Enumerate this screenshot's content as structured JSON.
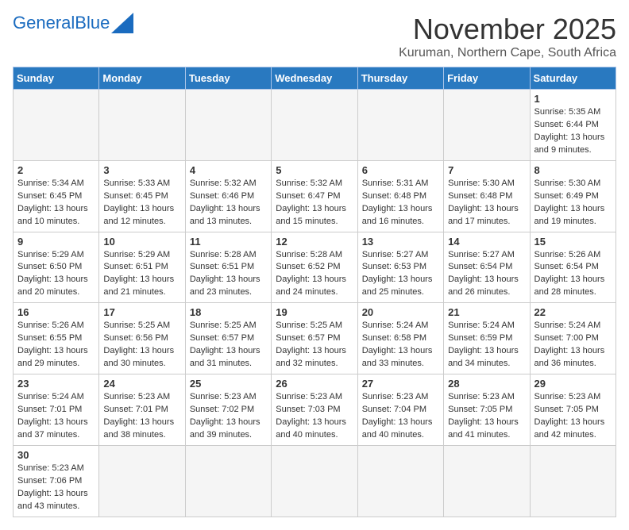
{
  "header": {
    "logo_general": "General",
    "logo_blue": "Blue",
    "month": "November 2025",
    "location": "Kuruman, Northern Cape, South Africa"
  },
  "days_of_week": [
    "Sunday",
    "Monday",
    "Tuesday",
    "Wednesday",
    "Thursday",
    "Friday",
    "Saturday"
  ],
  "weeks": [
    [
      {
        "day": "",
        "info": ""
      },
      {
        "day": "",
        "info": ""
      },
      {
        "day": "",
        "info": ""
      },
      {
        "day": "",
        "info": ""
      },
      {
        "day": "",
        "info": ""
      },
      {
        "day": "",
        "info": ""
      },
      {
        "day": "1",
        "info": "Sunrise: 5:35 AM\nSunset: 6:44 PM\nDaylight: 13 hours and 9 minutes."
      }
    ],
    [
      {
        "day": "2",
        "info": "Sunrise: 5:34 AM\nSunset: 6:45 PM\nDaylight: 13 hours and 10 minutes."
      },
      {
        "day": "3",
        "info": "Sunrise: 5:33 AM\nSunset: 6:45 PM\nDaylight: 13 hours and 12 minutes."
      },
      {
        "day": "4",
        "info": "Sunrise: 5:32 AM\nSunset: 6:46 PM\nDaylight: 13 hours and 13 minutes."
      },
      {
        "day": "5",
        "info": "Sunrise: 5:32 AM\nSunset: 6:47 PM\nDaylight: 13 hours and 15 minutes."
      },
      {
        "day": "6",
        "info": "Sunrise: 5:31 AM\nSunset: 6:48 PM\nDaylight: 13 hours and 16 minutes."
      },
      {
        "day": "7",
        "info": "Sunrise: 5:30 AM\nSunset: 6:48 PM\nDaylight: 13 hours and 17 minutes."
      },
      {
        "day": "8",
        "info": "Sunrise: 5:30 AM\nSunset: 6:49 PM\nDaylight: 13 hours and 19 minutes."
      }
    ],
    [
      {
        "day": "9",
        "info": "Sunrise: 5:29 AM\nSunset: 6:50 PM\nDaylight: 13 hours and 20 minutes."
      },
      {
        "day": "10",
        "info": "Sunrise: 5:29 AM\nSunset: 6:51 PM\nDaylight: 13 hours and 21 minutes."
      },
      {
        "day": "11",
        "info": "Sunrise: 5:28 AM\nSunset: 6:51 PM\nDaylight: 13 hours and 23 minutes."
      },
      {
        "day": "12",
        "info": "Sunrise: 5:28 AM\nSunset: 6:52 PM\nDaylight: 13 hours and 24 minutes."
      },
      {
        "day": "13",
        "info": "Sunrise: 5:27 AM\nSunset: 6:53 PM\nDaylight: 13 hours and 25 minutes."
      },
      {
        "day": "14",
        "info": "Sunrise: 5:27 AM\nSunset: 6:54 PM\nDaylight: 13 hours and 26 minutes."
      },
      {
        "day": "15",
        "info": "Sunrise: 5:26 AM\nSunset: 6:54 PM\nDaylight: 13 hours and 28 minutes."
      }
    ],
    [
      {
        "day": "16",
        "info": "Sunrise: 5:26 AM\nSunset: 6:55 PM\nDaylight: 13 hours and 29 minutes."
      },
      {
        "day": "17",
        "info": "Sunrise: 5:25 AM\nSunset: 6:56 PM\nDaylight: 13 hours and 30 minutes."
      },
      {
        "day": "18",
        "info": "Sunrise: 5:25 AM\nSunset: 6:57 PM\nDaylight: 13 hours and 31 minutes."
      },
      {
        "day": "19",
        "info": "Sunrise: 5:25 AM\nSunset: 6:57 PM\nDaylight: 13 hours and 32 minutes."
      },
      {
        "day": "20",
        "info": "Sunrise: 5:24 AM\nSunset: 6:58 PM\nDaylight: 13 hours and 33 minutes."
      },
      {
        "day": "21",
        "info": "Sunrise: 5:24 AM\nSunset: 6:59 PM\nDaylight: 13 hours and 34 minutes."
      },
      {
        "day": "22",
        "info": "Sunrise: 5:24 AM\nSunset: 7:00 PM\nDaylight: 13 hours and 36 minutes."
      }
    ],
    [
      {
        "day": "23",
        "info": "Sunrise: 5:24 AM\nSunset: 7:01 PM\nDaylight: 13 hours and 37 minutes."
      },
      {
        "day": "24",
        "info": "Sunrise: 5:23 AM\nSunset: 7:01 PM\nDaylight: 13 hours and 38 minutes."
      },
      {
        "day": "25",
        "info": "Sunrise: 5:23 AM\nSunset: 7:02 PM\nDaylight: 13 hours and 39 minutes."
      },
      {
        "day": "26",
        "info": "Sunrise: 5:23 AM\nSunset: 7:03 PM\nDaylight: 13 hours and 40 minutes."
      },
      {
        "day": "27",
        "info": "Sunrise: 5:23 AM\nSunset: 7:04 PM\nDaylight: 13 hours and 40 minutes."
      },
      {
        "day": "28",
        "info": "Sunrise: 5:23 AM\nSunset: 7:05 PM\nDaylight: 13 hours and 41 minutes."
      },
      {
        "day": "29",
        "info": "Sunrise: 5:23 AM\nSunset: 7:05 PM\nDaylight: 13 hours and 42 minutes."
      }
    ],
    [
      {
        "day": "30",
        "info": "Sunrise: 5:23 AM\nSunset: 7:06 PM\nDaylight: 13 hours and 43 minutes."
      },
      {
        "day": "",
        "info": ""
      },
      {
        "day": "",
        "info": ""
      },
      {
        "day": "",
        "info": ""
      },
      {
        "day": "",
        "info": ""
      },
      {
        "day": "",
        "info": ""
      },
      {
        "day": "",
        "info": ""
      }
    ]
  ]
}
